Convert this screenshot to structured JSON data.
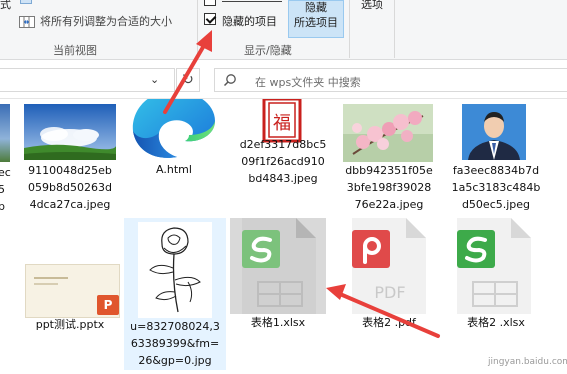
{
  "ribbon": {
    "partial_label_left": "式",
    "fit_columns_label": "将所有列调整为合适的大小",
    "current_view_label": "当前视图",
    "hidden_items_label": "隐藏的项目",
    "hidden_items_checked": true,
    "hide_selected_line1": "隐藏",
    "hide_selected_line2": "所选项目",
    "show_hide_label": "显示/隐藏",
    "options_label": "选项"
  },
  "address": {
    "search_placeholder": "在 wps文件夹 中搜索"
  },
  "files": {
    "row1": [
      {
        "name_lines": [
          "ec",
          "5",
          "b"
        ]
      },
      {
        "name_lines": [
          "9110048d25eb",
          "059b8d50263d",
          "4dca27ca.jpeg"
        ]
      },
      {
        "name_lines": [
          "A.html"
        ]
      },
      {
        "name_lines": [
          "d2ef3317d8bc5",
          "09f1f26acd910",
          "bd4843.jpeg"
        ]
      },
      {
        "name_lines": [
          "dbb942351f05e",
          "3bfe198f39028",
          "76e22a.jpeg"
        ]
      },
      {
        "name_lines": [
          "fa3eec8834b7d",
          "1a5c3183c484b",
          "d50ec5.jpeg"
        ]
      }
    ],
    "row2": [
      {
        "name_lines": [
          "ppt测试.pptx"
        ]
      },
      {
        "name_lines": [
          "u=832708024,3",
          "63389399&fm=",
          "26&gp=0.jpg"
        ]
      },
      {
        "name_lines": [
          "表格1.xlsx"
        ]
      },
      {
        "name_lines": [
          "表格2 .pdf"
        ]
      },
      {
        "name_lines": [
          "表格2 .xlsx"
        ]
      }
    ]
  },
  "icons": {
    "stamp_char": "福",
    "pdf_label": "PDF",
    "ppt_letter": "P"
  },
  "colors": {
    "accent_red": "#e8403b",
    "wps_green": "#4caf50",
    "pdf_red": "#e04a4a",
    "selection_blue": "#e5f3ff",
    "edge_blue": "#1a73d9"
  },
  "watermark": "jingyan.baidu.com"
}
